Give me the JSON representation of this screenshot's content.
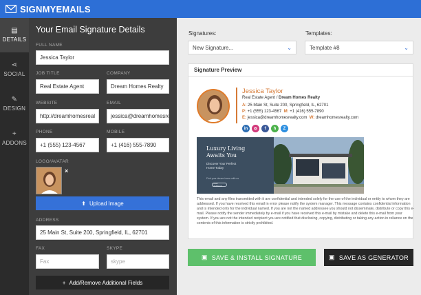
{
  "app": {
    "logo_text": "SIGNMYEMAILS"
  },
  "rail": [
    {
      "label": "DETAILS",
      "icon": "id-card-icon"
    },
    {
      "label": "SOCIAL",
      "icon": "share-icon"
    },
    {
      "label": "DESIGN",
      "icon": "brush-icon"
    },
    {
      "label": "ADDONS",
      "icon": "plus-icon"
    }
  ],
  "panel": {
    "title": "Your Email Signature Details",
    "full_name_label": "FULL NAME",
    "full_name": "Jessica Taylor",
    "job_title_label": "JOB TITLE",
    "job_title": "Real Estate Agent",
    "company_label": "COMPANY",
    "company": "Dream Homes Realty",
    "website_label": "WEBSITE",
    "website": "http://dreamhomesreal",
    "email_label": "EMAIL",
    "email": "jessica@dreamhomesre",
    "phone_label": "PHONE",
    "phone": "+1 (555) 123-4567",
    "mobile_label": "MOBILE",
    "mobile": "+1 (416) 555-7890",
    "logo_label": "LOGO/AVATAR",
    "remove_avatar": "×",
    "upload_label": "Upload Image",
    "address_label": "ADDRESS",
    "address": "25 Main St, Suite 200, Springfield, IL, 62701",
    "fax_label": "FAX",
    "fax_placeholder": "Fax",
    "skype_label": "SKYPE",
    "skype_placeholder": "skype",
    "add_fields_label": "Add/Remove Additional Fields"
  },
  "right": {
    "signatures_label": "Signatures:",
    "signatures_value": "New Signature...",
    "templates_label": "Templates:",
    "templates_value": "Template #8",
    "preview_title": "Signature Preview"
  },
  "signature": {
    "name": "Jessica Taylor",
    "title": "Real Estate Agent / ",
    "company": "Dream Homes Realty",
    "address_key": "A:",
    "address": "25 Main St, Suite 200, Springfield, IL, 62701",
    "phone_key": "P:",
    "phone": "+1 (555) 123-4567",
    "mobile_key": "M:",
    "mobile": "+1 (416) 555-7890",
    "email_key": "E:",
    "email": "jessica@dreamhomesrealty.com",
    "web_key": "W:",
    "web": "dreamhomesrealty.com",
    "socials": [
      {
        "name": "linkedin",
        "glyph": "in",
        "color": "#2f6fb3"
      },
      {
        "name": "instagram",
        "glyph": "◎",
        "color": "#d2387a"
      },
      {
        "name": "facebook",
        "glyph": "f",
        "color": "#3b5998"
      },
      {
        "name": "houzz",
        "glyph": "h",
        "color": "#4db24c"
      },
      {
        "name": "zillow",
        "glyph": "Z",
        "color": "#2d8fe0"
      }
    ],
    "banner_title_1": "Luxury Living",
    "banner_title_2": "Awaits You",
    "banner_sub_1": "Discover Your Perfect",
    "banner_sub_2": "Home Today",
    "banner_small": "Find your dream home with us",
    "banner_btn": "VIEW LISTINGS",
    "disclaimer": "This email and any files transmitted with it are confidential and intended solely for the use of the individual or entity to whom they are addressed. If you have received this email in error please notify the system manager. This message contains confidential information and is intended only for the individual named. If you are not the named addressee you should not disseminate, distribute or copy this e-mail. Please notify the sender immediately by e-mail if you have received this e-mail by mistake and delete this e-mail from your system. If you are not the intended recipient you are notified that disclosing, copying, distributing or taking any action in reliance on the contents of this information is strictly prohibited."
  },
  "actions": {
    "install_label": "SAVE & INSTALL SIGNATURE",
    "generator_label": "SAVE AS GENERATOR"
  },
  "colors": {
    "brand_blue": "#2d6fd6",
    "install_green": "#5ec06b",
    "accent_orange": "#d67a36"
  }
}
